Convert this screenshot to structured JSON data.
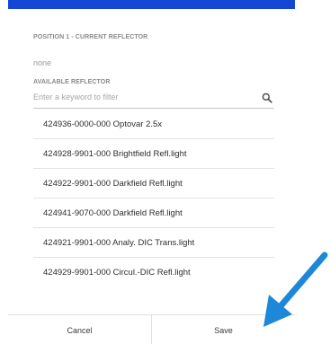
{
  "current_section": {
    "label": "POSITION 1 - CURRENT REFLECTOR",
    "value": "none"
  },
  "available_section": {
    "label": "AVAILABLE REFLECTOR",
    "search_placeholder": "Enter a keyword to filter",
    "search_icon": "search-icon"
  },
  "reflectors": [
    "424936-0000-000 Optovar 2.5x",
    "424928-9901-000 Brightfield Refl.light",
    "424922-9901-000 Darkfield Refl.light",
    "424941-9070-000 Darkfield Refl.light",
    "424921-9901-000 Analy. DIC Trans.light",
    "424929-9901-000 Circul.-DIC Refl.light"
  ],
  "footer": {
    "cancel_label": "Cancel",
    "save_label": "Save"
  },
  "colors": {
    "top_bar": "#1546d6",
    "annotation_arrow": "#1e88d8"
  }
}
